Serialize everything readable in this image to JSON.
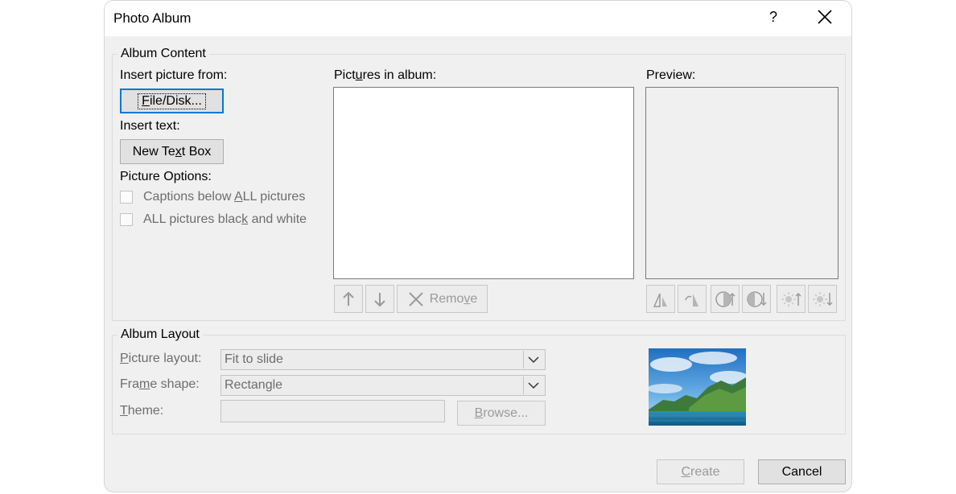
{
  "dialog": {
    "title": "Photo Album",
    "help": "?"
  },
  "content": {
    "legend": "Album Content",
    "insert_picture_from": "Insert picture from:",
    "file_disk_button": [
      "",
      "F",
      "ile/Disk..."
    ],
    "insert_text": "Insert text:",
    "new_text_box_button": [
      "New Te",
      "x",
      "t Box"
    ],
    "picture_options": "Picture Options:",
    "caption_option": [
      "Captions below ",
      "A",
      "LL pictures"
    ],
    "bw_option": [
      "ALL pictures blac",
      "k",
      " and white"
    ],
    "pictures_in_album": [
      "Pict",
      "u",
      "res in album:"
    ],
    "remove_button": [
      "Remo",
      "v",
      "e"
    ],
    "preview": "Preview:"
  },
  "layout": {
    "legend": "Album Layout",
    "picture_layout_label": [
      "",
      "P",
      "icture layout:"
    ],
    "picture_layout_value": "Fit to slide",
    "frame_shape_label": [
      "Fra",
      "m",
      "e shape:"
    ],
    "frame_shape_value": "Rectangle",
    "theme_label": [
      "",
      "T",
      "heme:"
    ],
    "theme_value": "",
    "browse_button": [
      "",
      "B",
      "rowse..."
    ]
  },
  "footer": {
    "create_button": [
      "",
      "C",
      "reate"
    ],
    "cancel_button": "Cancel"
  }
}
